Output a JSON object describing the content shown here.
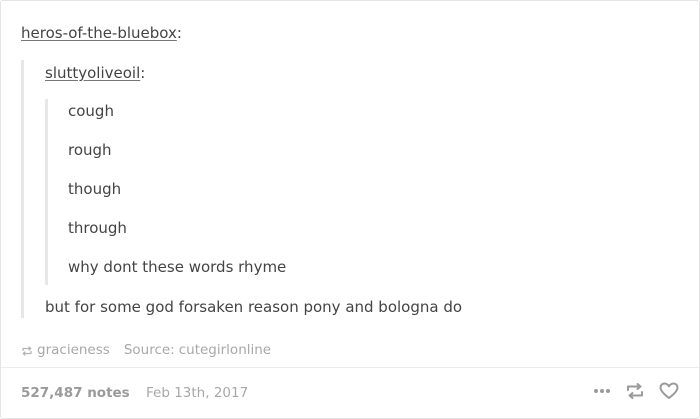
{
  "post": {
    "author": "heros-of-the-bluebox",
    "colon": ":",
    "quote": {
      "author": "sluttyoliveoil",
      "colon": ":",
      "lines": [
        "cough",
        "rough",
        "though",
        "through",
        "why dont these words rhyme"
      ]
    },
    "reply": "but for some god forsaken reason pony and bologna do"
  },
  "attribution": {
    "reblogged_from": "gracieness",
    "source_label": "Source:",
    "source": "cutegirlonline"
  },
  "footer": {
    "notes": "527,487 notes",
    "date": "Feb 13th, 2017"
  },
  "icons": {
    "more": "more-dots-icon",
    "reblog": "reblog-icon",
    "like": "heart-icon"
  },
  "colors": {
    "text": "#444444",
    "muted": "#a8a8a8",
    "border": "#e4e4e4",
    "quote_bar": "#e7e7e7"
  }
}
